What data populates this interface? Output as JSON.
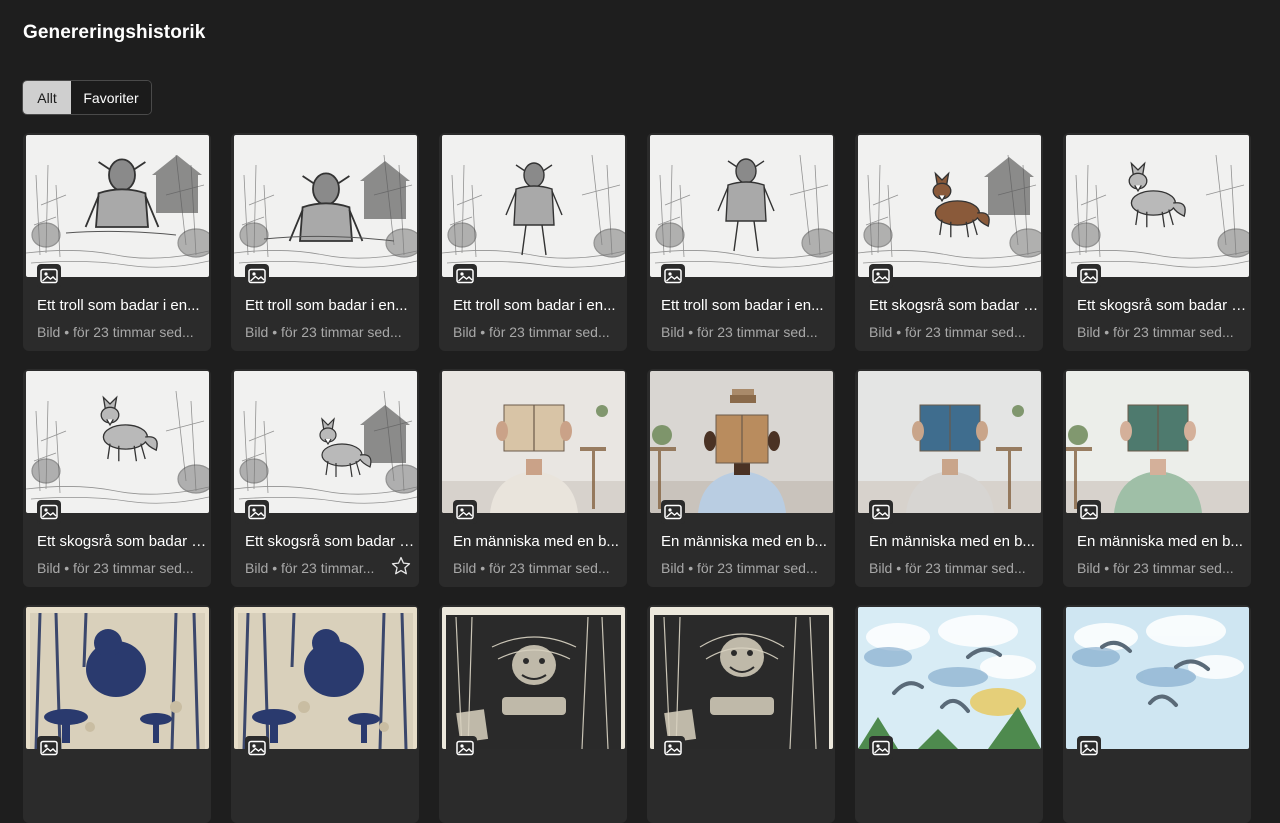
{
  "page": {
    "title": "Genereringshistorik"
  },
  "filters": {
    "all_label": "Allt",
    "favorites_label": "Favoriter"
  },
  "cards": [
    {
      "title": "Ett troll som badar i en...",
      "meta": "Bild • för 23 timmar sed...",
      "scene": "troll-sketch-a"
    },
    {
      "title": "Ett troll som badar i en...",
      "meta": "Bild • för 23 timmar sed...",
      "scene": "troll-sketch-b"
    },
    {
      "title": "Ett troll som badar i en...",
      "meta": "Bild • för 23 timmar sed...",
      "scene": "troll-sketch-c"
    },
    {
      "title": "Ett troll som badar i en...",
      "meta": "Bild • för 23 timmar sed...",
      "scene": "troll-sketch-d"
    },
    {
      "title": "Ett skogsrå som badar i...",
      "meta": "Bild • för 23 timmar sed...",
      "scene": "fox-sketch-a"
    },
    {
      "title": "Ett skogsrå som badar i...",
      "meta": "Bild • för 23 timmar sed...",
      "scene": "fox-sketch-b"
    },
    {
      "title": "Ett skogsrå som badar i...",
      "meta": "Bild • för 23 timmar sed...",
      "scene": "fox-sketch-c"
    },
    {
      "title": "Ett skogsrå som badar i...",
      "meta": "Bild • för 23 timmar...",
      "scene": "fox-sketch-d",
      "favorite_star": true
    },
    {
      "title": "En människa med en b...",
      "meta": "Bild • för 23 timmar sed...",
      "scene": "book-photo-a"
    },
    {
      "title": "En människa med en b...",
      "meta": "Bild • för 23 timmar sed...",
      "scene": "book-photo-b"
    },
    {
      "title": "En människa med en b...",
      "meta": "Bild • för 23 timmar sed...",
      "scene": "book-photo-c"
    },
    {
      "title": "En människa med en b...",
      "meta": "Bild • för 23 timmar sed...",
      "scene": "book-photo-d"
    },
    {
      "title": "",
      "meta": "",
      "scene": "blue-print-a"
    },
    {
      "title": "",
      "meta": "",
      "scene": "blue-print-b"
    },
    {
      "title": "",
      "meta": "",
      "scene": "woodcut-a"
    },
    {
      "title": "",
      "meta": "",
      "scene": "woodcut-b"
    },
    {
      "title": "",
      "meta": "",
      "scene": "watercolor-a"
    },
    {
      "title": "",
      "meta": "",
      "scene": "watercolor-b"
    }
  ],
  "icons": {
    "image_badge": "image-icon",
    "favorite": "star-outline-icon"
  },
  "colors": {
    "background": "#1e1e1e",
    "card": "#2b2b2b",
    "meta_text": "#a8a8a8"
  }
}
